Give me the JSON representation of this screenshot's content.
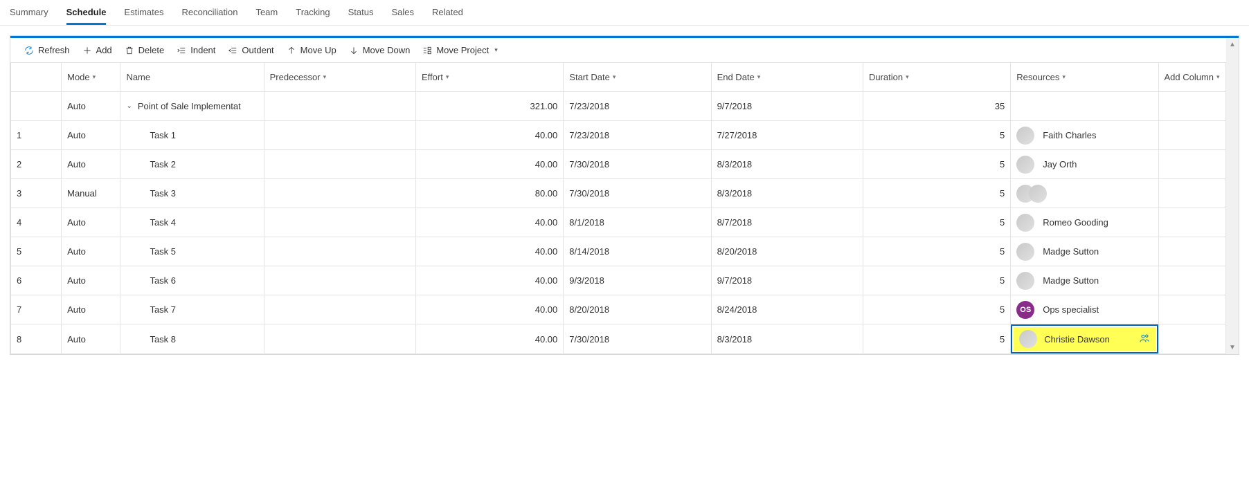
{
  "tabs": [
    "Summary",
    "Schedule",
    "Estimates",
    "Reconciliation",
    "Team",
    "Tracking",
    "Status",
    "Sales",
    "Related"
  ],
  "active_tab": "Schedule",
  "toolbar": {
    "refresh": "Refresh",
    "add": "Add",
    "delete": "Delete",
    "indent": "Indent",
    "outdent": "Outdent",
    "move_up": "Move Up",
    "move_down": "Move Down",
    "move_project": "Move Project"
  },
  "columns": {
    "mode": "Mode",
    "name": "Name",
    "predecessor": "Predecessor",
    "effort": "Effort",
    "start": "Start Date",
    "end": "End Date",
    "duration": "Duration",
    "resources": "Resources",
    "add": "Add Column"
  },
  "parent_row": {
    "mode": "Auto",
    "name": "Point of Sale Implementat",
    "effort": "321.00",
    "start": "7/23/2018",
    "end": "9/7/2018",
    "duration": "35"
  },
  "rows": [
    {
      "num": "1",
      "mode": "Auto",
      "name": "Task 1",
      "effort": "40.00",
      "start": "7/23/2018",
      "end": "7/27/2018",
      "duration": "5",
      "resource": "Faith Charles",
      "avatar_type": "photo"
    },
    {
      "num": "2",
      "mode": "Auto",
      "name": "Task 2",
      "effort": "40.00",
      "start": "7/30/2018",
      "end": "8/3/2018",
      "duration": "5",
      "resource": "Jay Orth",
      "avatar_type": "photo"
    },
    {
      "num": "3",
      "mode": "Manual",
      "name": "Task 3",
      "effort": "80.00",
      "start": "7/30/2018",
      "end": "8/3/2018",
      "duration": "5",
      "resource": "",
      "avatar_type": "pair"
    },
    {
      "num": "4",
      "mode": "Auto",
      "name": "Task 4",
      "effort": "40.00",
      "start": "8/1/2018",
      "end": "8/7/2018",
      "duration": "5",
      "resource": "Romeo Gooding",
      "avatar_type": "photo"
    },
    {
      "num": "5",
      "mode": "Auto",
      "name": "Task 5",
      "effort": "40.00",
      "start": "8/14/2018",
      "end": "8/20/2018",
      "duration": "5",
      "resource": "Madge Sutton",
      "avatar_type": "photo"
    },
    {
      "num": "6",
      "mode": "Auto",
      "name": "Task 6",
      "effort": "40.00",
      "start": "9/3/2018",
      "end": "9/7/2018",
      "duration": "5",
      "resource": "Madge Sutton",
      "avatar_type": "photo"
    },
    {
      "num": "7",
      "mode": "Auto",
      "name": "Task 7",
      "effort": "40.00",
      "start": "8/20/2018",
      "end": "8/24/2018",
      "duration": "5",
      "resource": "Ops specialist",
      "avatar_type": "initials",
      "initials": "OS",
      "color": "#8a2a8a"
    },
    {
      "num": "8",
      "mode": "Auto",
      "name": "Task 8",
      "effort": "40.00",
      "start": "7/30/2018",
      "end": "8/3/2018",
      "duration": "5",
      "resource": "Christie Dawson",
      "avatar_type": "photo",
      "selected": true
    }
  ]
}
